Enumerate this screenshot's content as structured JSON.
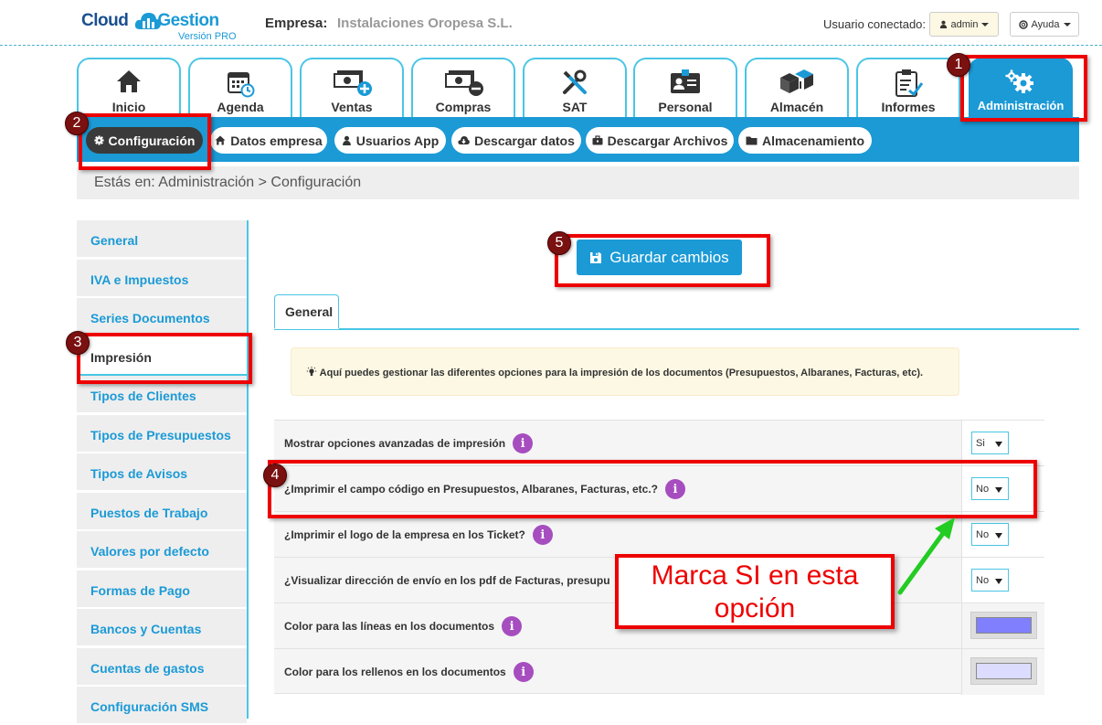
{
  "header": {
    "logo_part1": "Cloud",
    "logo_part2": "Gestion",
    "logo_version": "Versión PRO",
    "empresa_label": "Empresa:",
    "empresa_value": "Instalaciones Oropesa S.L.",
    "usuario_label": "Usuario conectado:",
    "admin_label": "admin",
    "ayuda_label": "Ayuda"
  },
  "module_tabs": [
    {
      "label": "Inicio",
      "icon": "home-icon"
    },
    {
      "label": "Agenda",
      "icon": "calendar-icon"
    },
    {
      "label": "Ventas",
      "icon": "money-plus-icon"
    },
    {
      "label": "Compras",
      "icon": "money-minus-icon"
    },
    {
      "label": "SAT",
      "icon": "tools-icon"
    },
    {
      "label": "Personal",
      "icon": "id-card-icon"
    },
    {
      "label": "Almacén",
      "icon": "boxes-icon"
    },
    {
      "label": "Informes",
      "icon": "clipboard-icon"
    },
    {
      "label": "Administración",
      "icon": "gears-icon"
    }
  ],
  "subnav": [
    {
      "label": "Configuración",
      "icon": "gear-icon"
    },
    {
      "label": "Datos empresa",
      "icon": "home-icon"
    },
    {
      "label": "Usuarios App",
      "icon": "user-icon"
    },
    {
      "label": "Descargar datos",
      "icon": "cloud-download-icon"
    },
    {
      "label": "Descargar Archivos",
      "icon": "briefcase-icon"
    },
    {
      "label": "Almacenamiento",
      "icon": "folder-icon"
    }
  ],
  "breadcrumb": "Estás en: Administración > Configuración",
  "sidebar": [
    "General",
    "IVA e Impuestos",
    "Series Documentos",
    "Impresión",
    "Tipos de Clientes",
    "Tipos de Presupuestos",
    "Tipos de Avisos",
    "Puestos de Trabajo",
    "Valores por defecto",
    "Formas de Pago",
    "Bancos y Cuentas",
    "Cuentas de gastos",
    "Configuración SMS"
  ],
  "sidebar_active": "Impresión",
  "save_button": "Guardar cambios",
  "tab_general": "General",
  "info_text": "Aquí puedes gestionar las diferentes opciones para la impresión de los documentos (Presupuestos, Albaranes, Facturas, etc).",
  "settings": [
    {
      "label": "Mostrar opciones avanzadas de impresión",
      "value": "Si"
    },
    {
      "label": "¿Imprimir el campo código en Presupuestos, Albaranes, Facturas, etc.?",
      "value": "No"
    },
    {
      "label": "¿Imprimir el logo de la empresa en los Ticket?",
      "value": "No"
    },
    {
      "label": "¿Visualizar dirección de envío en los pdf de Facturas, presupu",
      "value": "No"
    },
    {
      "label": "Color para las líneas en los documentos",
      "color": "#8080ff"
    },
    {
      "label": "Color para los rellenos en los documentos",
      "color": "#dcdcff"
    }
  ],
  "annotations": {
    "markers": [
      "1",
      "2",
      "3",
      "4",
      "5"
    ],
    "callout": "Marca SI en esta opción",
    "box_color": "#ee0000",
    "arrow_color": "#22cc22"
  },
  "colors": {
    "primary": "#1b9ad6",
    "tab_border": "#49c6e5",
    "info_purple": "#a64dbf",
    "dark_pill": "#3a3a3a"
  }
}
